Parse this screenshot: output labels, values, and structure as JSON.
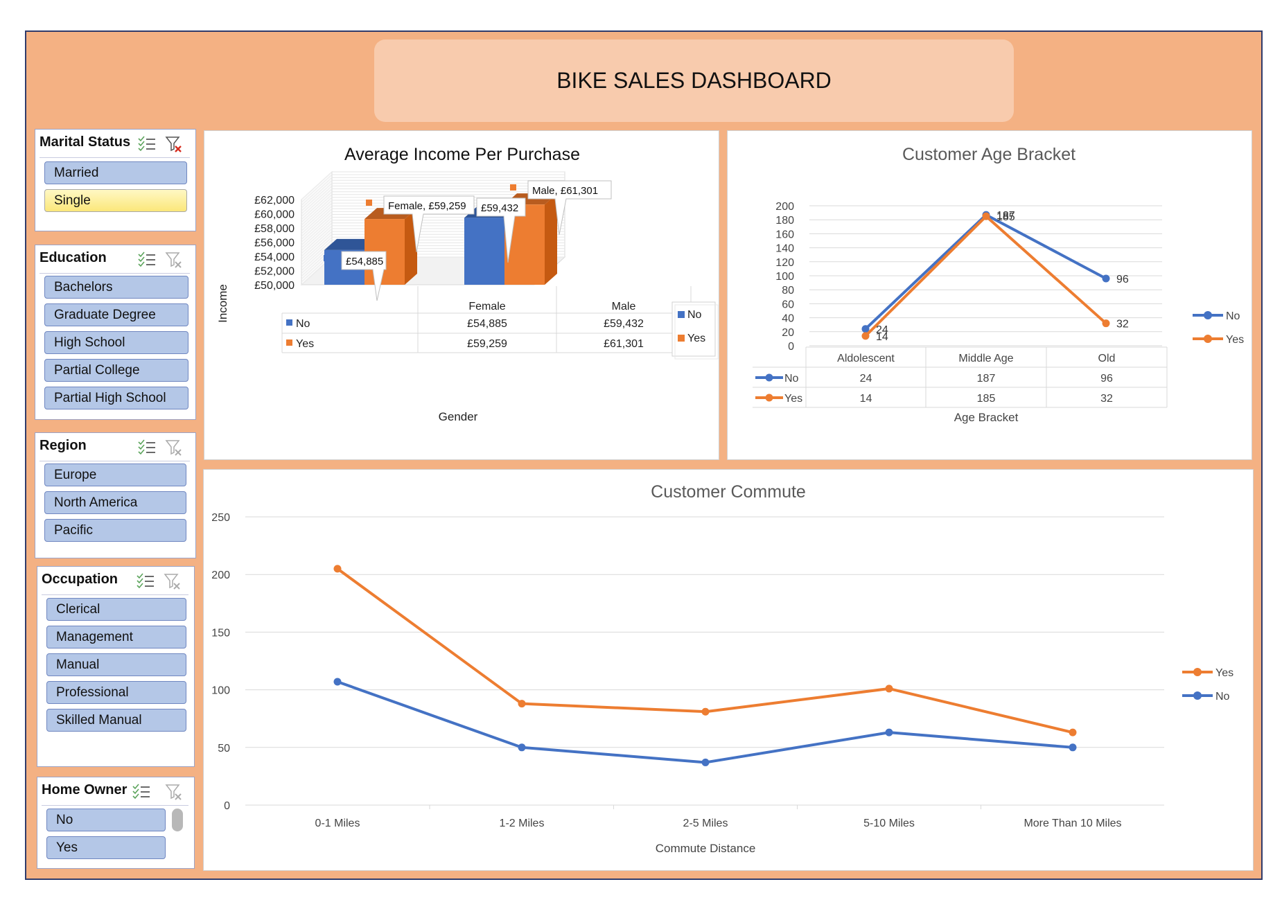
{
  "dashboard": {
    "title": "BIKE SALES DASHBOARD"
  },
  "colors": {
    "background": "#f4b183",
    "title_box": "#f8cbad",
    "no_series": "#4472c4",
    "yes_series": "#ed7d31",
    "slicer_item": "#b4c7e7",
    "slicer_selected": "#fbe77a"
  },
  "slicers": {
    "marital": {
      "title": "Marital Status",
      "items": [
        "Married",
        "Single"
      ],
      "selected": "Single"
    },
    "education": {
      "title": "Education",
      "items": [
        "Bachelors",
        "Graduate Degree",
        "High School",
        "Partial College",
        "Partial High School"
      ]
    },
    "region": {
      "title": "Region",
      "items": [
        "Europe",
        "North America",
        "Pacific"
      ]
    },
    "occupation": {
      "title": "Occupation",
      "items": [
        "Clerical",
        "Management",
        "Manual",
        "Professional",
        "Skilled Manual"
      ]
    },
    "home_owner": {
      "title": "Home Owner",
      "items": [
        "No",
        "Yes"
      ]
    }
  },
  "chart_data": [
    {
      "type": "bar",
      "title": "Average Income Per Purchase",
      "xlabel": "Gender",
      "ylabel": "Income",
      "categories": [
        "Female",
        "Male"
      ],
      "series": [
        {
          "name": "No",
          "values": [
            54885,
            59432
          ],
          "labels": [
            "£54,885",
            "£59,432"
          ]
        },
        {
          "name": "Yes",
          "values": [
            59259,
            61301
          ],
          "labels": [
            "£59,259",
            "£61,301"
          ]
        }
      ],
      "ylim": [
        50000,
        62000
      ],
      "yticks": [
        "£50,000",
        "£52,000",
        "£54,000",
        "£56,000",
        "£58,000",
        "£60,000",
        "£62,000"
      ],
      "callouts": [
        "£54,885",
        "Female, £59,259",
        "£59,432",
        "Male, £61,301"
      ],
      "data_table": true,
      "legend": "right"
    },
    {
      "type": "line",
      "title": "Customer Age Bracket",
      "xlabel": "Age Bracket",
      "ylabel": "",
      "categories": [
        "Aldolescent",
        "Middle Age",
        "Old"
      ],
      "series": [
        {
          "name": "No",
          "values": [
            24,
            187,
            96
          ]
        },
        {
          "name": "Yes",
          "values": [
            14,
            185,
            32
          ]
        }
      ],
      "ylim": [
        0,
        200
      ],
      "yticks": [
        "0",
        "20",
        "40",
        "60",
        "80",
        "100",
        "120",
        "140",
        "160",
        "180",
        "200"
      ],
      "data_table": true,
      "legend": "right"
    },
    {
      "type": "line",
      "title": "Customer Commute",
      "xlabel": "Commute Distance",
      "ylabel": "",
      "categories": [
        "0-1 Miles",
        "1-2 Miles",
        "2-5 Miles",
        "5-10 Miles",
        "More Than 10 Miles"
      ],
      "series": [
        {
          "name": "Yes",
          "values": [
            205,
            88,
            81,
            101,
            63
          ]
        },
        {
          "name": "No",
          "values": [
            107,
            50,
            37,
            63,
            50
          ]
        }
      ],
      "ylim": [
        0,
        250
      ],
      "yticks": [
        "0",
        "50",
        "100",
        "150",
        "200",
        "250"
      ],
      "legend": "right"
    }
  ]
}
